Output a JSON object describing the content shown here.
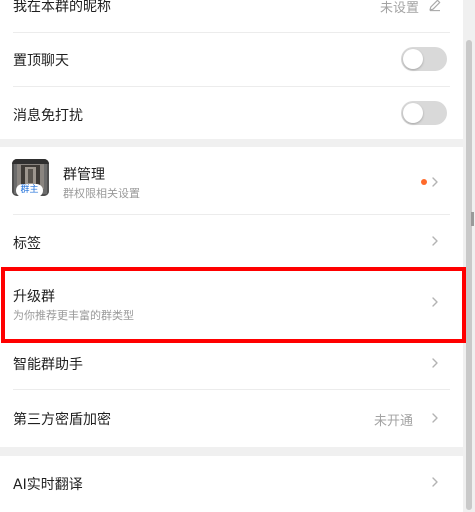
{
  "settings": {
    "nickname": {
      "label": "我在本群的昵称",
      "value": "未设置"
    },
    "pin_chat": {
      "label": "置顶聊天",
      "on": false
    },
    "mute": {
      "label": "消息免打扰",
      "on": false
    },
    "group_manage": {
      "label": "群管理",
      "sub": "群权限相关设置",
      "badge": "群主"
    },
    "tags": {
      "label": "标签"
    },
    "upgrade": {
      "label": "升级群",
      "sub": "为你推荐更丰富的群类型"
    },
    "assistant": {
      "label": "智能群助手"
    },
    "encryption": {
      "label": "第三方密盾加密",
      "value": "未开通"
    },
    "translate": {
      "label": "AI实时翻译"
    }
  },
  "colors": {
    "highlight": "#ff0000",
    "notify_dot": "#ff6a2b",
    "toggle_off": "#d9d9d9",
    "badge_text": "#1e6fd9"
  }
}
